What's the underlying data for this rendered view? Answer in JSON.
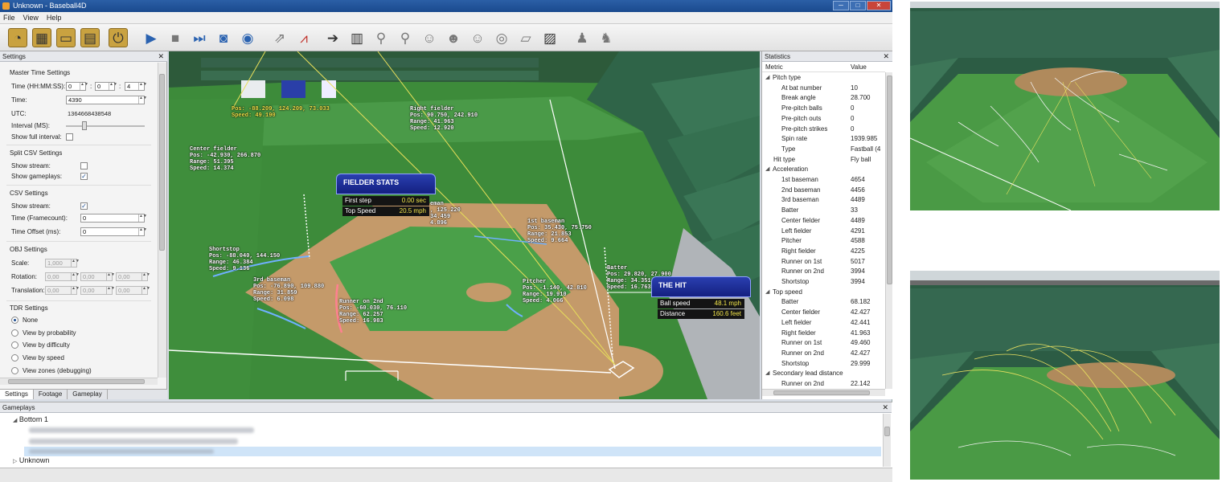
{
  "window": {
    "title": "Unknown - Baseball4D",
    "min": "─",
    "max": "□",
    "close": "✕"
  },
  "menu": [
    "File",
    "View",
    "Help"
  ],
  "toolbar_icons": [
    "open-file-icon",
    "open-calendar-icon",
    "open-folder-icon",
    "save-icon",
    "power-icon",
    "play-icon",
    "stop-icon",
    "fast-forward-icon",
    "camera-icon",
    "camera-refresh-icon",
    "export-icon",
    "chart-icon",
    "next-icon",
    "film-icon",
    "pin-icon",
    "pin-add-icon",
    "add-person-icon",
    "remove-person-icon",
    "person-settings-icon",
    "camera-settings-icon",
    "comment-icon",
    "image-icon",
    "group-icon",
    "group-export-icon"
  ],
  "settings": {
    "title": "Settings",
    "master": "Master Time Settings",
    "time_hms_label": "Time (HH:MM:SS):",
    "h": "0",
    "m": "0",
    "s": "4",
    "time_label": "Time:",
    "time": "4390",
    "utc_label": "UTC:",
    "utc": "1364668438548",
    "interval_label": "Interval (MS):",
    "show_full_label": "Show full interval:",
    "split_csv": "Split CSV Settings",
    "show_stream_label": "Show stream:",
    "show_gameplays_label": "Show gameplays:",
    "csv": "CSV Settings",
    "csv_show_stream_label": "Show stream:",
    "framecount_label": "Time (Framecount):",
    "framecount": "0",
    "offset_label": "Time Offset (ms):",
    "offset": "0",
    "obj": "OBJ Settings",
    "scale_label": "Scale:",
    "scale": "1,000",
    "rotation_label": "Rotation:",
    "rot": [
      "0,00",
      "0,00",
      "0,00"
    ],
    "translation_label": "Translation:",
    "trans": [
      "0,00",
      "0,00",
      "0,00"
    ],
    "tdr": "TDR Settings",
    "tdr_options": [
      "None",
      "View by probability",
      "View by difficulty",
      "View by speed",
      "View zones (debugging)"
    ]
  },
  "tabs": [
    "Settings",
    "Footage",
    "Gameplay"
  ],
  "overlays": {
    "fielder_stats_title": "FIELDER STATS",
    "first_step_label": "First step",
    "first_step": "0.00 sec",
    "top_speed_label": "Top Speed",
    "top_speed": "20.5 mph",
    "the_hit_title": "THE HIT",
    "ball_speed_label": "Ball speed",
    "ball_speed": "48.1 mph",
    "distance_label": "Distance",
    "distance": "160.6 feet",
    "ball_pos": "Pos: -88.209, 124.209, 73.033\nSpeed: 49.190",
    "right_fielder": "Right fielder\nPos: 90.750, 242.910\nRange: 41.963\nSpeed: 12.920",
    "center_fielder": "Center fielder\nPos: -42.930, 266.870\nRange: 51.395\nSpeed: 14.374",
    "second_baseman": "eman\n, 125.220\n34.459\n4.896",
    "first_baseman": "1st baseman\nPos: 35.430, 75.750\nRange: 21.853\nSpeed: 9.664",
    "shortstop": "Shortstop\nPos: -88.040, 144.150\nRange: 46.384\nSpeed: 9.136",
    "third_baseman": "3rd baseman\nPos: -76.890, 109.880\nRange: 31.859\nSpeed: 6.098",
    "runner_on_2nd": "Runner on 2nd\nPos: -60.030, 76.110\nRange: 62.257\nSpeed: 16.983",
    "pitcher": "Pitcher\nPos: -1.140, 42.810\nRange: 19.910\nSpeed: 4.066",
    "batter": "Batter\nPos: 29.820, 27.900\nRange: 34.351\nSpeed: 16.763"
  },
  "stats": {
    "title": "Statistics",
    "col_metric": "Metric",
    "col_value": "Value",
    "rows": [
      {
        "m": "Pitch type",
        "v": "",
        "lvl": 0,
        "exp": true
      },
      {
        "m": "At bat number",
        "v": "10",
        "lvl": 2
      },
      {
        "m": "Break angle",
        "v": "28.700",
        "lvl": 2
      },
      {
        "m": "Pre-pitch balls",
        "v": "0",
        "lvl": 2
      },
      {
        "m": "Pre-pitch outs",
        "v": "0",
        "lvl": 2
      },
      {
        "m": "Pre-pitch strikes",
        "v": "0",
        "lvl": 2
      },
      {
        "m": "Spin rate",
        "v": "1939.985",
        "lvl": 2
      },
      {
        "m": "Type",
        "v": "Fastball (4",
        "lvl": 2
      },
      {
        "m": "Hit type",
        "v": "Fly ball",
        "lvl": 1
      },
      {
        "m": "Acceleration",
        "v": "",
        "lvl": 0,
        "exp": true
      },
      {
        "m": "1st baseman",
        "v": "4654",
        "lvl": 2
      },
      {
        "m": "2nd baseman",
        "v": "4456",
        "lvl": 2
      },
      {
        "m": "3rd baseman",
        "v": "4489",
        "lvl": 2
      },
      {
        "m": "Batter",
        "v": "33",
        "lvl": 2
      },
      {
        "m": "Center fielder",
        "v": "4489",
        "lvl": 2
      },
      {
        "m": "Left fielder",
        "v": "4291",
        "lvl": 2
      },
      {
        "m": "Pitcher",
        "v": "4588",
        "lvl": 2
      },
      {
        "m": "Right fielder",
        "v": "4225",
        "lvl": 2
      },
      {
        "m": "Runner on 1st",
        "v": "5017",
        "lvl": 2
      },
      {
        "m": "Runner on 2nd",
        "v": "3994",
        "lvl": 2
      },
      {
        "m": "Shortstop",
        "v": "3994",
        "lvl": 2
      },
      {
        "m": "Top speed",
        "v": "",
        "lvl": 0,
        "exp": true
      },
      {
        "m": "Batter",
        "v": "68.182",
        "lvl": 2
      },
      {
        "m": "Center fielder",
        "v": "42.427",
        "lvl": 2
      },
      {
        "m": "Left fielder",
        "v": "42.441",
        "lvl": 2
      },
      {
        "m": "Right fielder",
        "v": "41.963",
        "lvl": 2
      },
      {
        "m": "Runner on 1st",
        "v": "49.460",
        "lvl": 2
      },
      {
        "m": "Runner on 2nd",
        "v": "42.427",
        "lvl": 2
      },
      {
        "m": "Shortstop",
        "v": "29.999",
        "lvl": 2
      },
      {
        "m": "Secondary lead distance",
        "v": "",
        "lvl": 0,
        "exp": true
      },
      {
        "m": "Runner on 2nd",
        "v": "22.142",
        "lvl": 2
      }
    ]
  },
  "gameplays": {
    "title": "Gameplays",
    "group": "Bottom 1",
    "other": "Unknown"
  },
  "colors": {
    "accent": "#1a4a8e",
    "overlay_box": "#1c2f8f",
    "overlay_value": "#f0e44a"
  }
}
